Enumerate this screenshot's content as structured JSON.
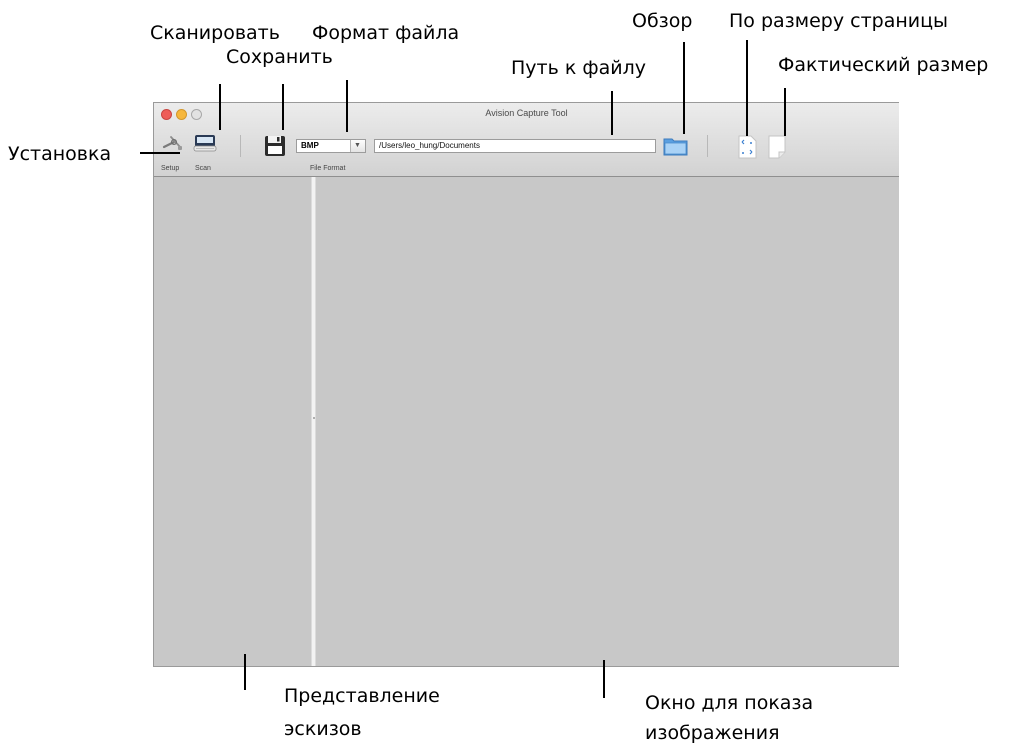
{
  "callouts": {
    "scan": "Сканировать",
    "save": "Сохранить",
    "file_format": "Формат файла",
    "browse": "Обзор",
    "fit_page": "По размеру страницы",
    "file_path": "Путь к файлу",
    "actual_size": "Фактический размер",
    "setup": "Установка",
    "thumbnail_view_line1": "Представление",
    "thumbnail_view_line2": "эскизов",
    "image_window_line1": "Окно для показа",
    "image_window_line2": "изображения"
  },
  "window": {
    "title": "Avision Capture Tool"
  },
  "toolbar": {
    "setup_label": "Setup",
    "scan_label": "Scan",
    "file_format_label": "File Format",
    "file_format_value": "BMP",
    "file_path_value": "/Users/leo_hung/Documents"
  },
  "colors": {
    "content_bg": "#c8c8c8",
    "close": "#ee5d58",
    "minimize": "#f6b73c",
    "folder_blue": "#4a90d9"
  },
  "icons": {
    "setup": "tools-icon",
    "scan": "scanner-icon",
    "save": "floppy-disk-icon",
    "browse": "folder-icon",
    "fit_page": "fit-page-icon",
    "actual_size": "actual-size-page-icon"
  }
}
